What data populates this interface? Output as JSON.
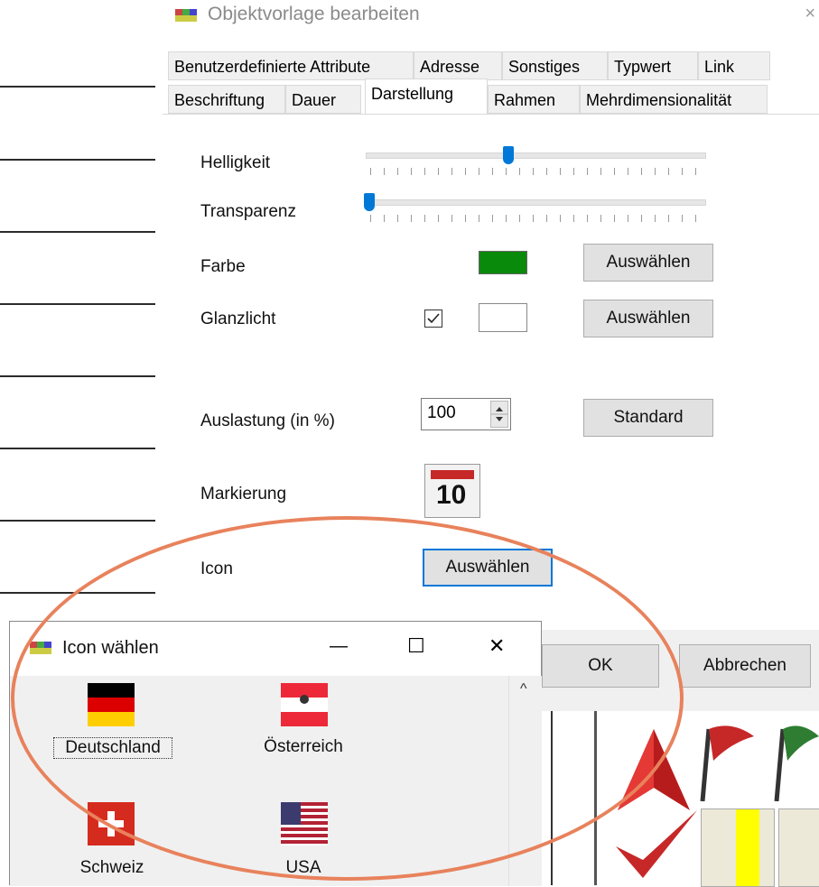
{
  "dialog": {
    "title": "Objektvorlage bearbeiten",
    "close_glyph": "×",
    "tabs_row1": [
      "Benutzerdefinierte Attribute",
      "Adresse",
      "Sonstiges",
      "Typwert",
      "Link"
    ],
    "tabs_row2": [
      "Beschriftung",
      "Dauer",
      "Darstellung",
      "Rahmen",
      "Mehrdimensionalität"
    ],
    "active_tab": "Darstellung"
  },
  "panel": {
    "helligkeit": {
      "label": "Helligkeit",
      "value": 0.41
    },
    "transparenz": {
      "label": "Transparenz",
      "value": 0.0
    },
    "farbe": {
      "label": "Farbe",
      "color": "#0a8a0a",
      "button": "Auswählen"
    },
    "glanzlicht": {
      "label": "Glanzlicht",
      "checked": true,
      "color": "#ffffff",
      "button": "Auswählen"
    },
    "auslastung": {
      "label": "Auslastung (in %)",
      "value": "100",
      "button": "Standard"
    },
    "markierung": {
      "label": "Markierung",
      "icon": "calendar-icon",
      "icon_text": "10"
    },
    "icon": {
      "label": "Icon",
      "button": "Auswählen"
    }
  },
  "footer": {
    "ok": "OK",
    "cancel": "Abbrechen"
  },
  "icon_window": {
    "title": "Icon wählen",
    "minimize": "—",
    "maximize": "☐",
    "close": "✕",
    "scroll_up": "^",
    "items": [
      {
        "label": "Deutschland",
        "icon": "flag-germany-icon"
      },
      {
        "label": "Österreich",
        "icon": "flag-austria-icon"
      },
      {
        "label": "Schweiz",
        "icon": "flag-switzerland-icon"
      },
      {
        "label": "USA",
        "icon": "flag-usa-icon"
      }
    ]
  },
  "colors": {
    "accent": "#0078d7",
    "highlight_ellipse": "#e8825c"
  }
}
